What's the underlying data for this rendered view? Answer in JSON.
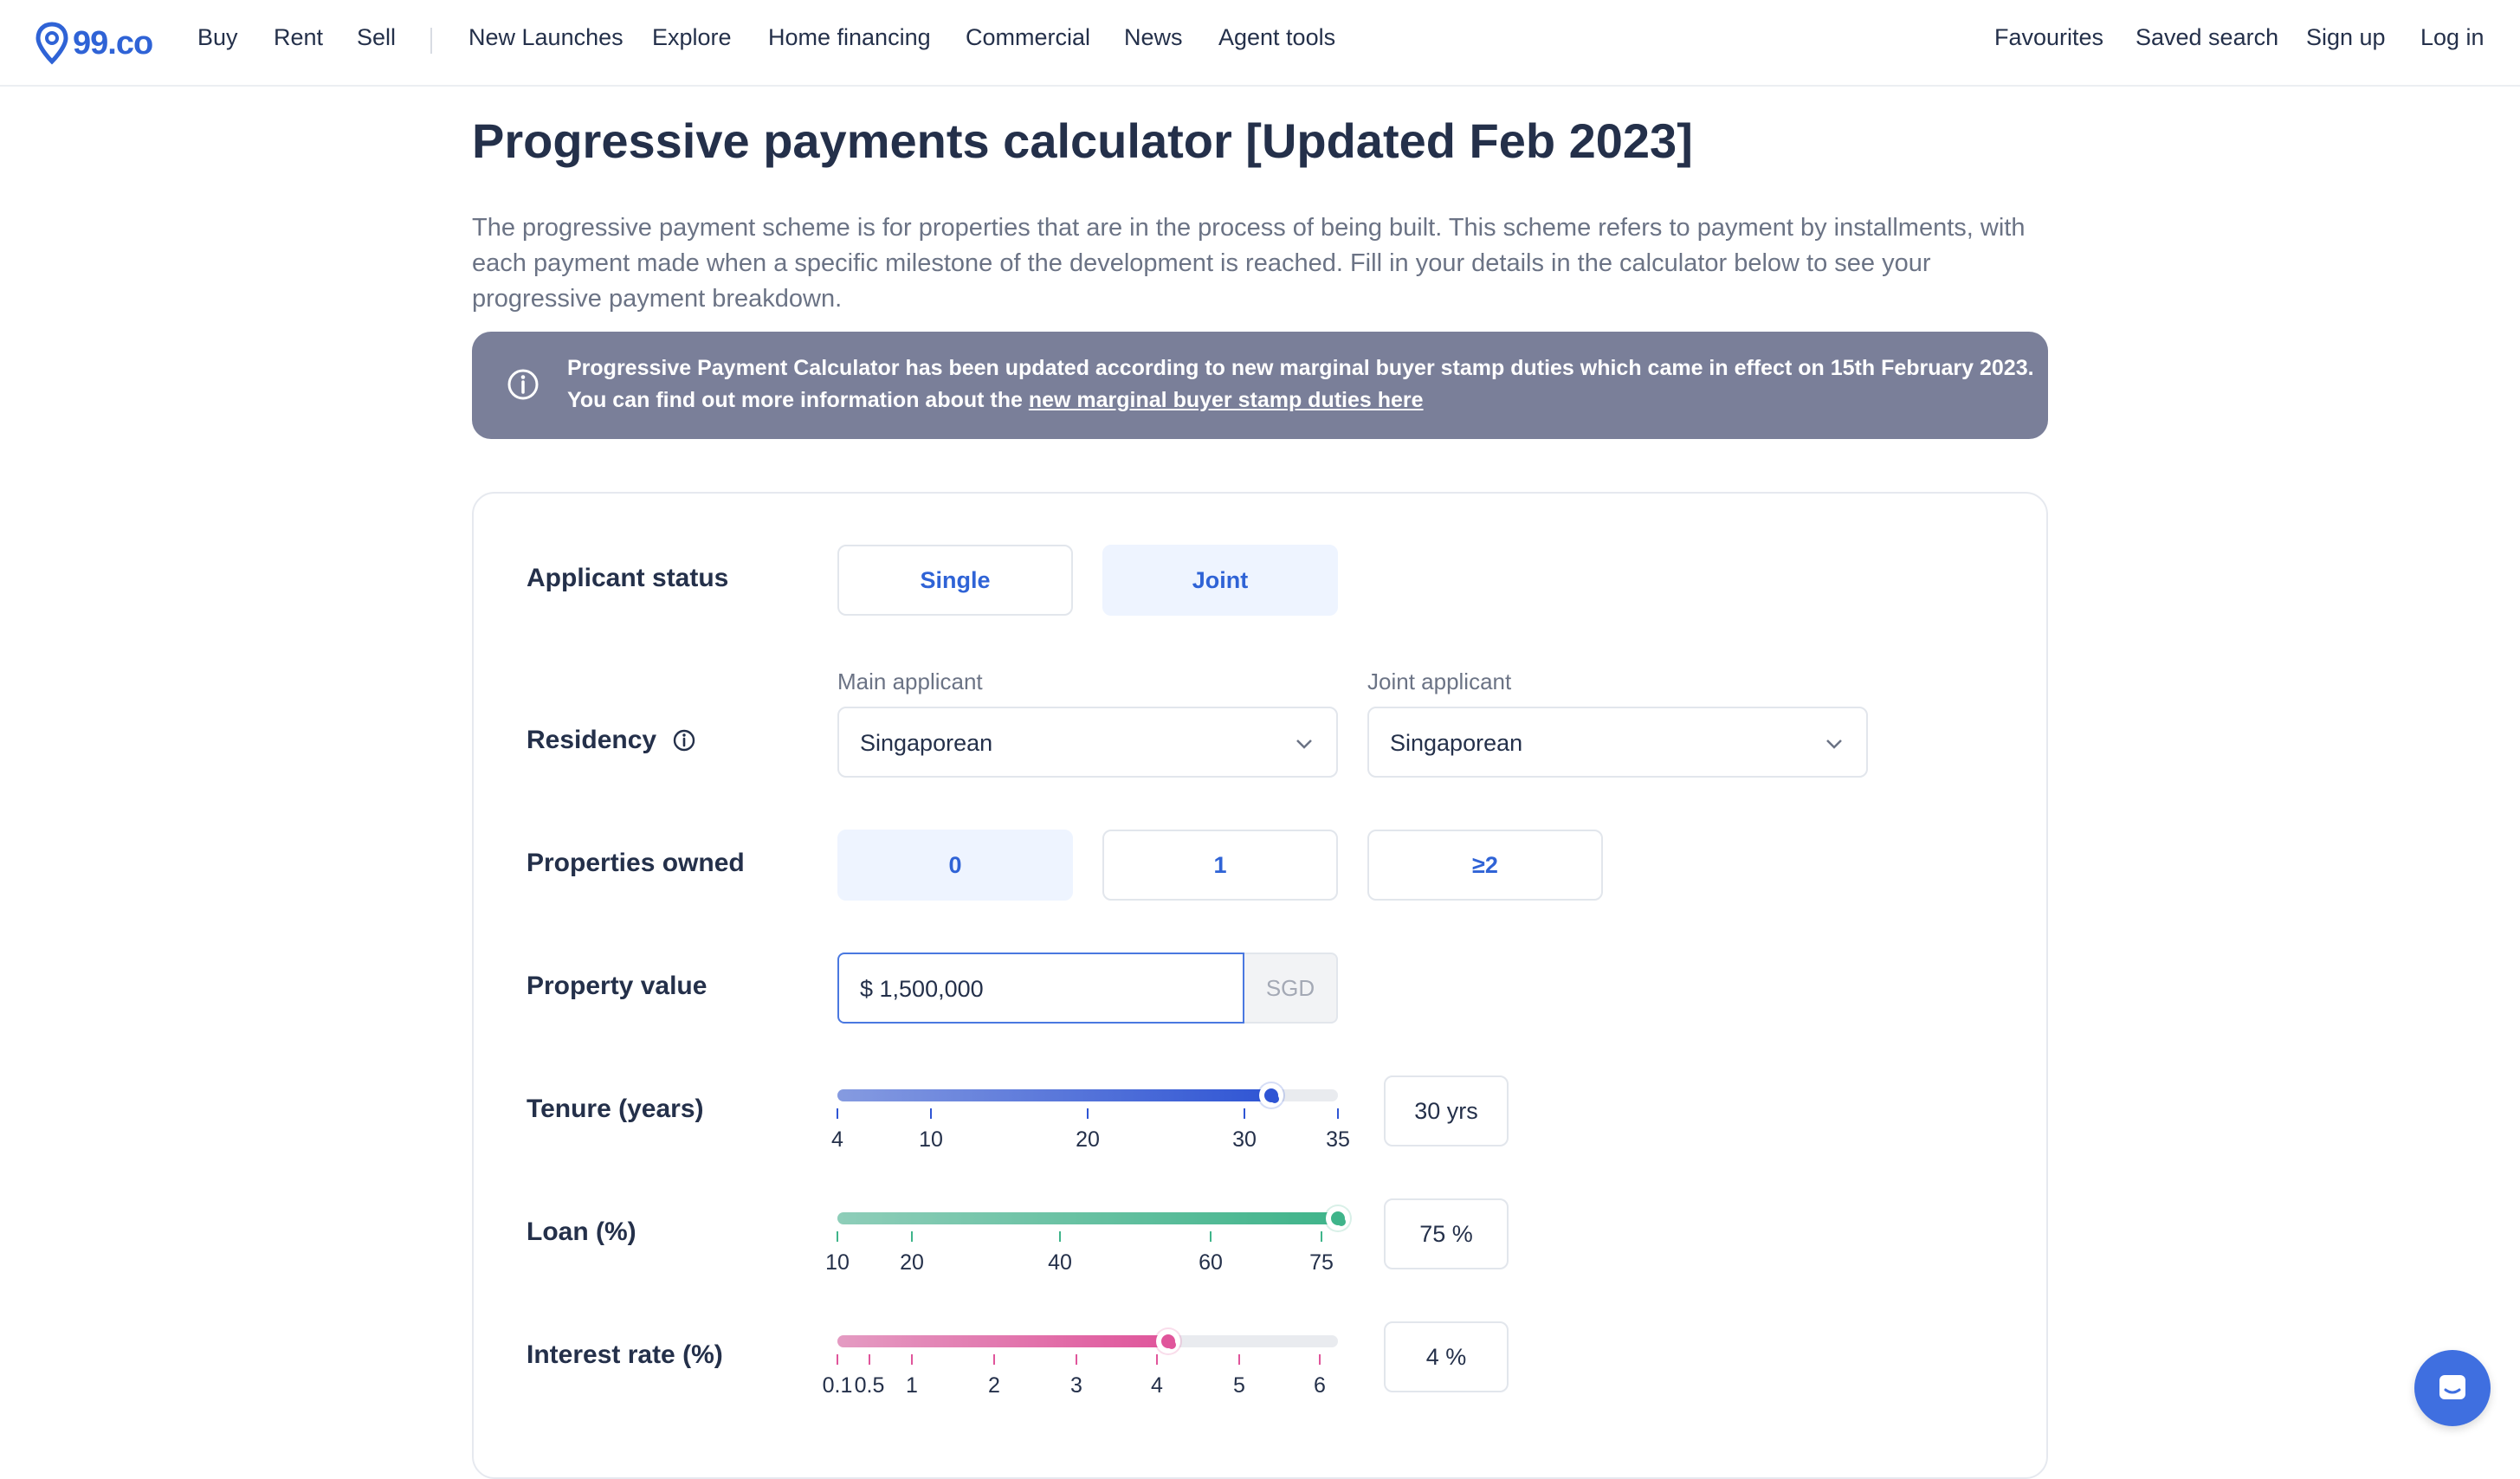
{
  "brand": {
    "logo_text": "99.co",
    "color": "#2f63d6"
  },
  "nav": {
    "left": [
      "Buy",
      "Rent",
      "Sell"
    ],
    "center": [
      "New Launches",
      "Explore",
      "Home financing",
      "Commercial",
      "News",
      "Agent tools"
    ],
    "right": [
      "Favourites",
      "Saved search",
      "Sign up",
      "Log in"
    ]
  },
  "page": {
    "title": "Progressive payments calculator [Updated Feb 2023]",
    "intro": "The progressive payment scheme is for properties that are in the process of being built. This scheme refers to payment by installments, with each payment made when a specific milestone of the development is reached. Fill in your details in the calculator below to see your progressive payment breakdown."
  },
  "notice": {
    "line1": "Progressive Payment Calculator has been updated according to new marginal buyer stamp duties which came in effect on 15th February 2023.",
    "line2_prefix": "You can find out more information about the ",
    "link": "new marginal buyer stamp duties here",
    "background": "#7a7f99"
  },
  "calculator": {
    "applicant_status": {
      "label": "Applicant status",
      "options": [
        "Single",
        "Joint"
      ],
      "selected": "Joint"
    },
    "residency": {
      "label": "Residency",
      "main_label": "Main applicant",
      "main_value": "Singaporean",
      "joint_label": "Joint applicant",
      "joint_value": "Singaporean"
    },
    "properties_owned": {
      "label": "Properties owned",
      "options": [
        "0",
        "1",
        "≥2"
      ],
      "selected": "0"
    },
    "property_value": {
      "label": "Property value",
      "value": "$ 1,500,000",
      "unit": "SGD"
    },
    "tenure": {
      "label": "Tenure (years)",
      "display": "30 yrs",
      "value": 30,
      "min": 4,
      "max": 35,
      "ticks": [
        "4",
        "10",
        "20",
        "30",
        "35"
      ],
      "color": "#2f55d4"
    },
    "loan": {
      "label": "Loan (%)",
      "display": "75 %",
      "value": 75,
      "min": 10,
      "max": 75,
      "ticks": [
        "10",
        "20",
        "40",
        "60",
        "75"
      ],
      "color": "#3fb48a"
    },
    "interest": {
      "label": "Interest rate (%)",
      "display": "4 %",
      "value": 4,
      "min": 0.1,
      "max": 6,
      "ticks": [
        "0.1",
        "0.5",
        "1",
        "2",
        "3",
        "4",
        "5",
        "6"
      ],
      "color": "#e0559b"
    }
  }
}
